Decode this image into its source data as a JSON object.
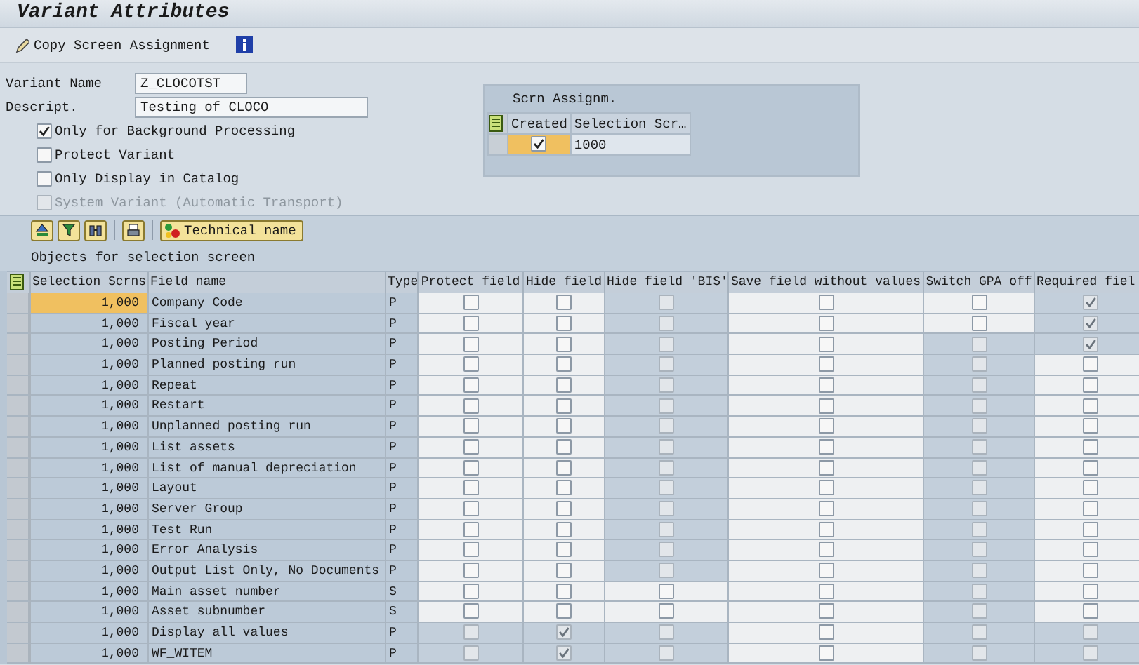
{
  "window": {
    "title": "Variant Attributes"
  },
  "toolbar": {
    "buttons": [
      {
        "label": "Copy Screen Assignment"
      }
    ]
  },
  "fields": [
    {
      "label": "Variant Name",
      "value": "Z_CLOCOTST"
    },
    {
      "label": "Descript.",
      "value": "Testing of CLOCO"
    }
  ],
  "options": [
    {
      "label": "Only for Background Processing",
      "checked": true,
      "disabled": false
    },
    {
      "label": "Protect Variant",
      "checked": false,
      "disabled": false
    },
    {
      "label": "Only Display in Catalog",
      "checked": false,
      "disabled": false
    },
    {
      "label": "System Variant (Automatic Transport)",
      "checked": false,
      "disabled": true
    }
  ],
  "screen_assignment": {
    "title": "Scrn Assignm.",
    "columns": [
      "Created",
      "Selection Scr…"
    ],
    "rows": [
      {
        "created": true,
        "selected": true,
        "screen": "1000"
      }
    ]
  },
  "table_toolbar": {
    "buttons": [
      {
        "label": "Technical name"
      }
    ]
  },
  "table": {
    "title": "Objects for selection screen",
    "columns": [
      "Selection Scrns",
      "Field name",
      "Type",
      "Protect field",
      "Hide field",
      "Hide field 'BIS'",
      "Save field without values",
      "Switch GPA off",
      "Required fiel"
    ],
    "rows": [
      {
        "screens": "1,000",
        "field": "Company Code",
        "type": "P",
        "selected": true,
        "checked": [
          false,
          false,
          false,
          false,
          false,
          true
        ],
        "editable": [
          true,
          true,
          false,
          true,
          true,
          false
        ]
      },
      {
        "screens": "1,000",
        "field": "Fiscal year",
        "type": "P",
        "selected": false,
        "checked": [
          false,
          false,
          false,
          false,
          false,
          true
        ],
        "editable": [
          true,
          true,
          false,
          true,
          true,
          false
        ]
      },
      {
        "screens": "1,000",
        "field": "Posting Period",
        "type": "P",
        "selected": false,
        "checked": [
          false,
          false,
          false,
          false,
          false,
          true
        ],
        "editable": [
          true,
          true,
          false,
          true,
          false,
          false
        ]
      },
      {
        "screens": "1,000",
        "field": "Planned posting run",
        "type": "P",
        "selected": false,
        "checked": [
          false,
          false,
          false,
          false,
          false,
          false
        ],
        "editable": [
          true,
          true,
          false,
          true,
          false,
          true
        ]
      },
      {
        "screens": "1,000",
        "field": "Repeat",
        "type": "P",
        "selected": false,
        "checked": [
          false,
          false,
          false,
          false,
          false,
          false
        ],
        "editable": [
          true,
          true,
          false,
          true,
          false,
          true
        ]
      },
      {
        "screens": "1,000",
        "field": "Restart",
        "type": "P",
        "selected": false,
        "checked": [
          false,
          false,
          false,
          false,
          false,
          false
        ],
        "editable": [
          true,
          true,
          false,
          true,
          false,
          true
        ]
      },
      {
        "screens": "1,000",
        "field": "Unplanned posting run",
        "type": "P",
        "selected": false,
        "checked": [
          false,
          false,
          false,
          false,
          false,
          false
        ],
        "editable": [
          true,
          true,
          false,
          true,
          false,
          true
        ]
      },
      {
        "screens": "1,000",
        "field": "List assets",
        "type": "P",
        "selected": false,
        "checked": [
          false,
          false,
          false,
          false,
          false,
          false
        ],
        "editable": [
          true,
          true,
          false,
          true,
          false,
          true
        ]
      },
      {
        "screens": "1,000",
        "field": "List of manual depreciation",
        "type": "P",
        "selected": false,
        "checked": [
          false,
          false,
          false,
          false,
          false,
          false
        ],
        "editable": [
          true,
          true,
          false,
          true,
          false,
          true
        ]
      },
      {
        "screens": "1,000",
        "field": "Layout",
        "type": "P",
        "selected": false,
        "checked": [
          false,
          false,
          false,
          false,
          false,
          false
        ],
        "editable": [
          true,
          true,
          false,
          true,
          false,
          true
        ]
      },
      {
        "screens": "1,000",
        "field": "Server Group",
        "type": "P",
        "selected": false,
        "checked": [
          false,
          false,
          false,
          false,
          false,
          false
        ],
        "editable": [
          true,
          true,
          false,
          true,
          false,
          true
        ]
      },
      {
        "screens": "1,000",
        "field": "Test Run",
        "type": "P",
        "selected": false,
        "checked": [
          false,
          false,
          false,
          false,
          false,
          false
        ],
        "editable": [
          true,
          true,
          false,
          true,
          false,
          true
        ]
      },
      {
        "screens": "1,000",
        "field": "Error Analysis",
        "type": "P",
        "selected": false,
        "checked": [
          false,
          false,
          false,
          false,
          false,
          false
        ],
        "editable": [
          true,
          true,
          false,
          true,
          false,
          true
        ]
      },
      {
        "screens": "1,000",
        "field": "Output List Only, No Documents",
        "type": "P",
        "selected": false,
        "checked": [
          false,
          false,
          false,
          false,
          false,
          false
        ],
        "editable": [
          true,
          true,
          false,
          true,
          false,
          true
        ]
      },
      {
        "screens": "1,000",
        "field": "Main asset number",
        "type": "S",
        "selected": false,
        "checked": [
          false,
          false,
          false,
          false,
          false,
          false
        ],
        "editable": [
          true,
          true,
          true,
          true,
          false,
          true
        ]
      },
      {
        "screens": "1,000",
        "field": "Asset subnumber",
        "type": "S",
        "selected": false,
        "checked": [
          false,
          false,
          false,
          false,
          false,
          false
        ],
        "editable": [
          true,
          true,
          true,
          true,
          false,
          true
        ]
      },
      {
        "screens": "1,000",
        "field": "Display all values",
        "type": "P",
        "selected": false,
        "checked": [
          false,
          true,
          false,
          false,
          false,
          false
        ],
        "editable": [
          false,
          false,
          false,
          true,
          false,
          false
        ]
      },
      {
        "screens": "1,000",
        "field": "WF_WITEM",
        "type": "P",
        "selected": false,
        "checked": [
          false,
          true,
          false,
          false,
          false,
          false
        ],
        "editable": [
          false,
          false,
          false,
          true,
          false,
          false
        ]
      }
    ]
  }
}
